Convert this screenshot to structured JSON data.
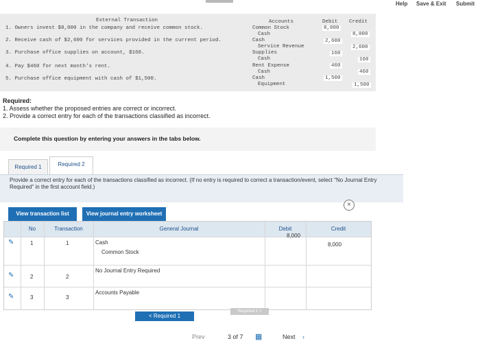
{
  "header": {
    "help": "Help",
    "save_exit": "Save & Exit",
    "submit": "Submit"
  },
  "external": {
    "title": "External Transaction",
    "col_accounts": "Accounts",
    "col_debit": "Debit",
    "col_credit": "Credit",
    "transactions": [
      "1. Owners invest $8,000 in the company and receive common stock.",
      "2. Receive cash of $2,600 for services provided in the current period.",
      "3. Purchase office supplies on account, $160.",
      "4. Pay $460 for next month's rent.",
      "5. Purchase office equipment with cash of $1,500."
    ],
    "accounts": [
      "Common Stock",
      "Cash",
      "Cash",
      "Service Revenue",
      "Supplies",
      "Cash",
      "Rent Expense",
      "Cash",
      "Cash",
      "Equipment"
    ],
    "debits": [
      "8,000",
      "2,600",
      "160",
      "460",
      "1,500"
    ],
    "credits": [
      "8,000",
      "2,600",
      "160",
      "460",
      "1,500"
    ]
  },
  "required": {
    "heading": "Required:",
    "line1": "1. Assess whether the proposed entries are correct or incorrect.",
    "line2": "2. Provide a correct entry for each of the transactions classified as incorrect."
  },
  "complete_prompt": "Complete this question by entering your answers in the tabs below.",
  "tabs": [
    "Required 1",
    "Required 2"
  ],
  "instruction": "Provide a correct entry for each of the transactions classified as incorrect. (If no entry is required to correct a transaction/event, select \"No Journal Entry Required\" in the first account field.)",
  "buttons": {
    "view_list": "View transaction list",
    "view_worksheet": "View journal entry worksheet"
  },
  "table": {
    "headers": {
      "no": "No",
      "transaction": "Transaction",
      "general_journal": "General Journal",
      "debit": "Debit",
      "credit": "Credit"
    },
    "rows": [
      {
        "no": "1",
        "txn": "1",
        "acct1": "Cash",
        "acct2": "Common Stock",
        "debit": "8,000",
        "credit": "8,000"
      },
      {
        "no": "2",
        "txn": "2",
        "acct1": "No Journal Entry Required"
      },
      {
        "no": "3",
        "txn": "3",
        "acct1": "Accounts Payable"
      }
    ]
  },
  "nav": {
    "req_prev": "< Required 1",
    "req_next": "Required 2 >",
    "prev": "Prev",
    "page": "3 of 7",
    "next": "Next"
  }
}
